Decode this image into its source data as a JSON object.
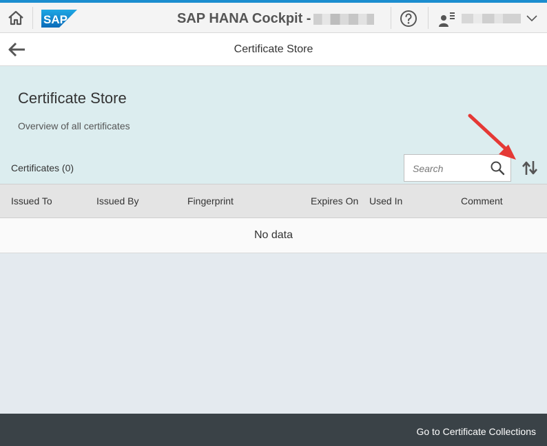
{
  "shell": {
    "logo_text": "SAP",
    "title": "SAP HANA Cockpit -",
    "accent_color": "#1b8dcf",
    "icons": [
      "home-icon",
      "help-icon",
      "user-icon",
      "chevron-down-icon"
    ]
  },
  "page_header": {
    "title": "Certificate Store",
    "back_icon": "arrow-left-icon"
  },
  "object_header": {
    "title": "Certificate Store",
    "subtitle": "Overview of all certificates"
  },
  "table": {
    "count_label": "Certificates (0)",
    "search_placeholder": "Search",
    "sort_icon": "sort-icon",
    "columns": [
      "Issued To",
      "Issued By",
      "Fingerprint",
      "Expires On",
      "Used In",
      "Comment"
    ],
    "rows": [],
    "no_data_text": "No data"
  },
  "annotation": {
    "color": "#e53935",
    "points_to": "sort-button"
  },
  "footer": {
    "button_label": "Go to Certificate Collections"
  }
}
